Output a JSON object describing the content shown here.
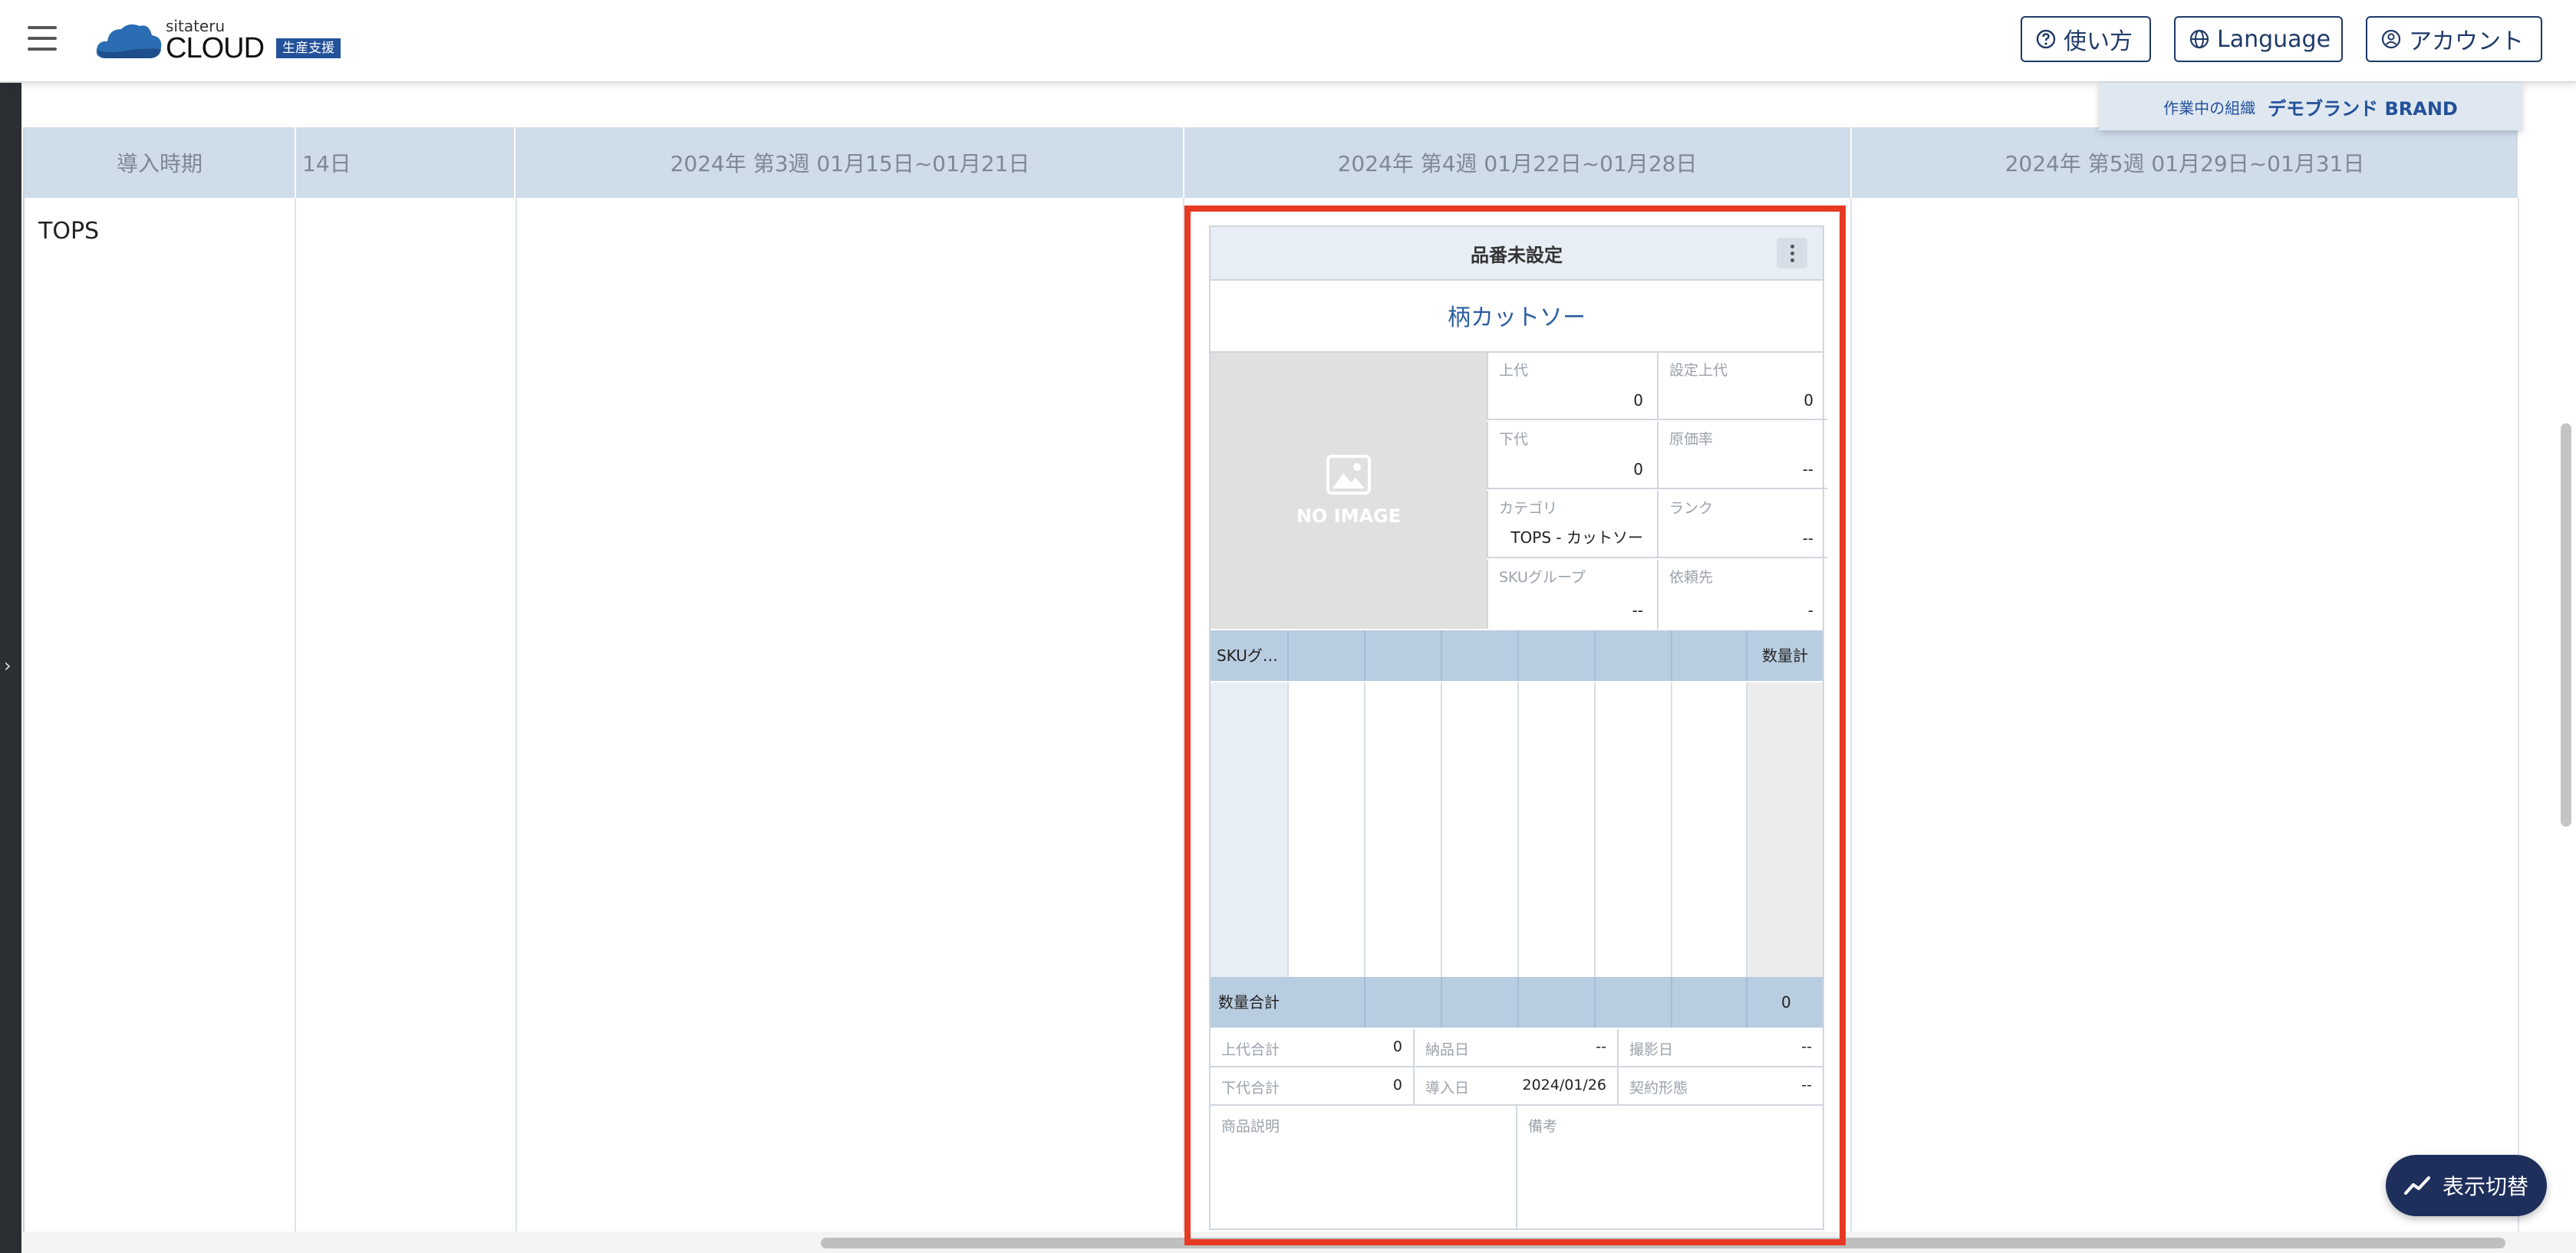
{
  "header": {
    "logo_small": "sitateru",
    "logo_big": "CLOUD",
    "logo_badge": "生産支援",
    "buttons": {
      "help": "使い方",
      "language": "Language",
      "account": "アカウント"
    }
  },
  "org": {
    "label": "作業中の組織",
    "name": "デモブランド BRAND"
  },
  "table": {
    "headers": [
      "導入時期",
      "14日",
      "2024年 第3週 01月15日~01月21日",
      "2024年 第4週 01月22日~01月28日",
      "2024年 第5週 01月29日~01月31日"
    ],
    "row_label": "TOPS"
  },
  "card": {
    "code": "品番未設定",
    "name": "柄カットソー",
    "no_image": "NO IMAGE",
    "attrs": [
      {
        "k": "上代",
        "v": "0"
      },
      {
        "k": "設定上代",
        "v": "0"
      },
      {
        "k": "下代",
        "v": "0"
      },
      {
        "k": "原価率",
        "v": "--"
      },
      {
        "k": "カテゴリ",
        "v": "TOPS - カットソー"
      },
      {
        "k": "ランク",
        "v": "--"
      },
      {
        "k": "SKUグループ",
        "v": "--"
      },
      {
        "k": "依頼先",
        "v": "-"
      }
    ],
    "sku_header": "SKUグ…",
    "qty_header": "数量計",
    "sum_label": "数量合計",
    "sum_value": "0",
    "footer": [
      {
        "k": "上代合計",
        "v": "0"
      },
      {
        "k": "納品日",
        "v": "--"
      },
      {
        "k": "撮影日",
        "v": "--"
      },
      {
        "k": "下代合計",
        "v": "0"
      },
      {
        "k": "導入日",
        "v": "2024/01/26"
      },
      {
        "k": "契約形態",
        "v": "--"
      }
    ],
    "memo_labels": {
      "description": "商品説明",
      "remarks": "備考"
    }
  },
  "toggle_label": "表示切替",
  "colors": {
    "accent": "#1f3a68",
    "highlight": "#e63a24",
    "header_bg": "#cfdcea",
    "link": "#2a5ea0"
  }
}
